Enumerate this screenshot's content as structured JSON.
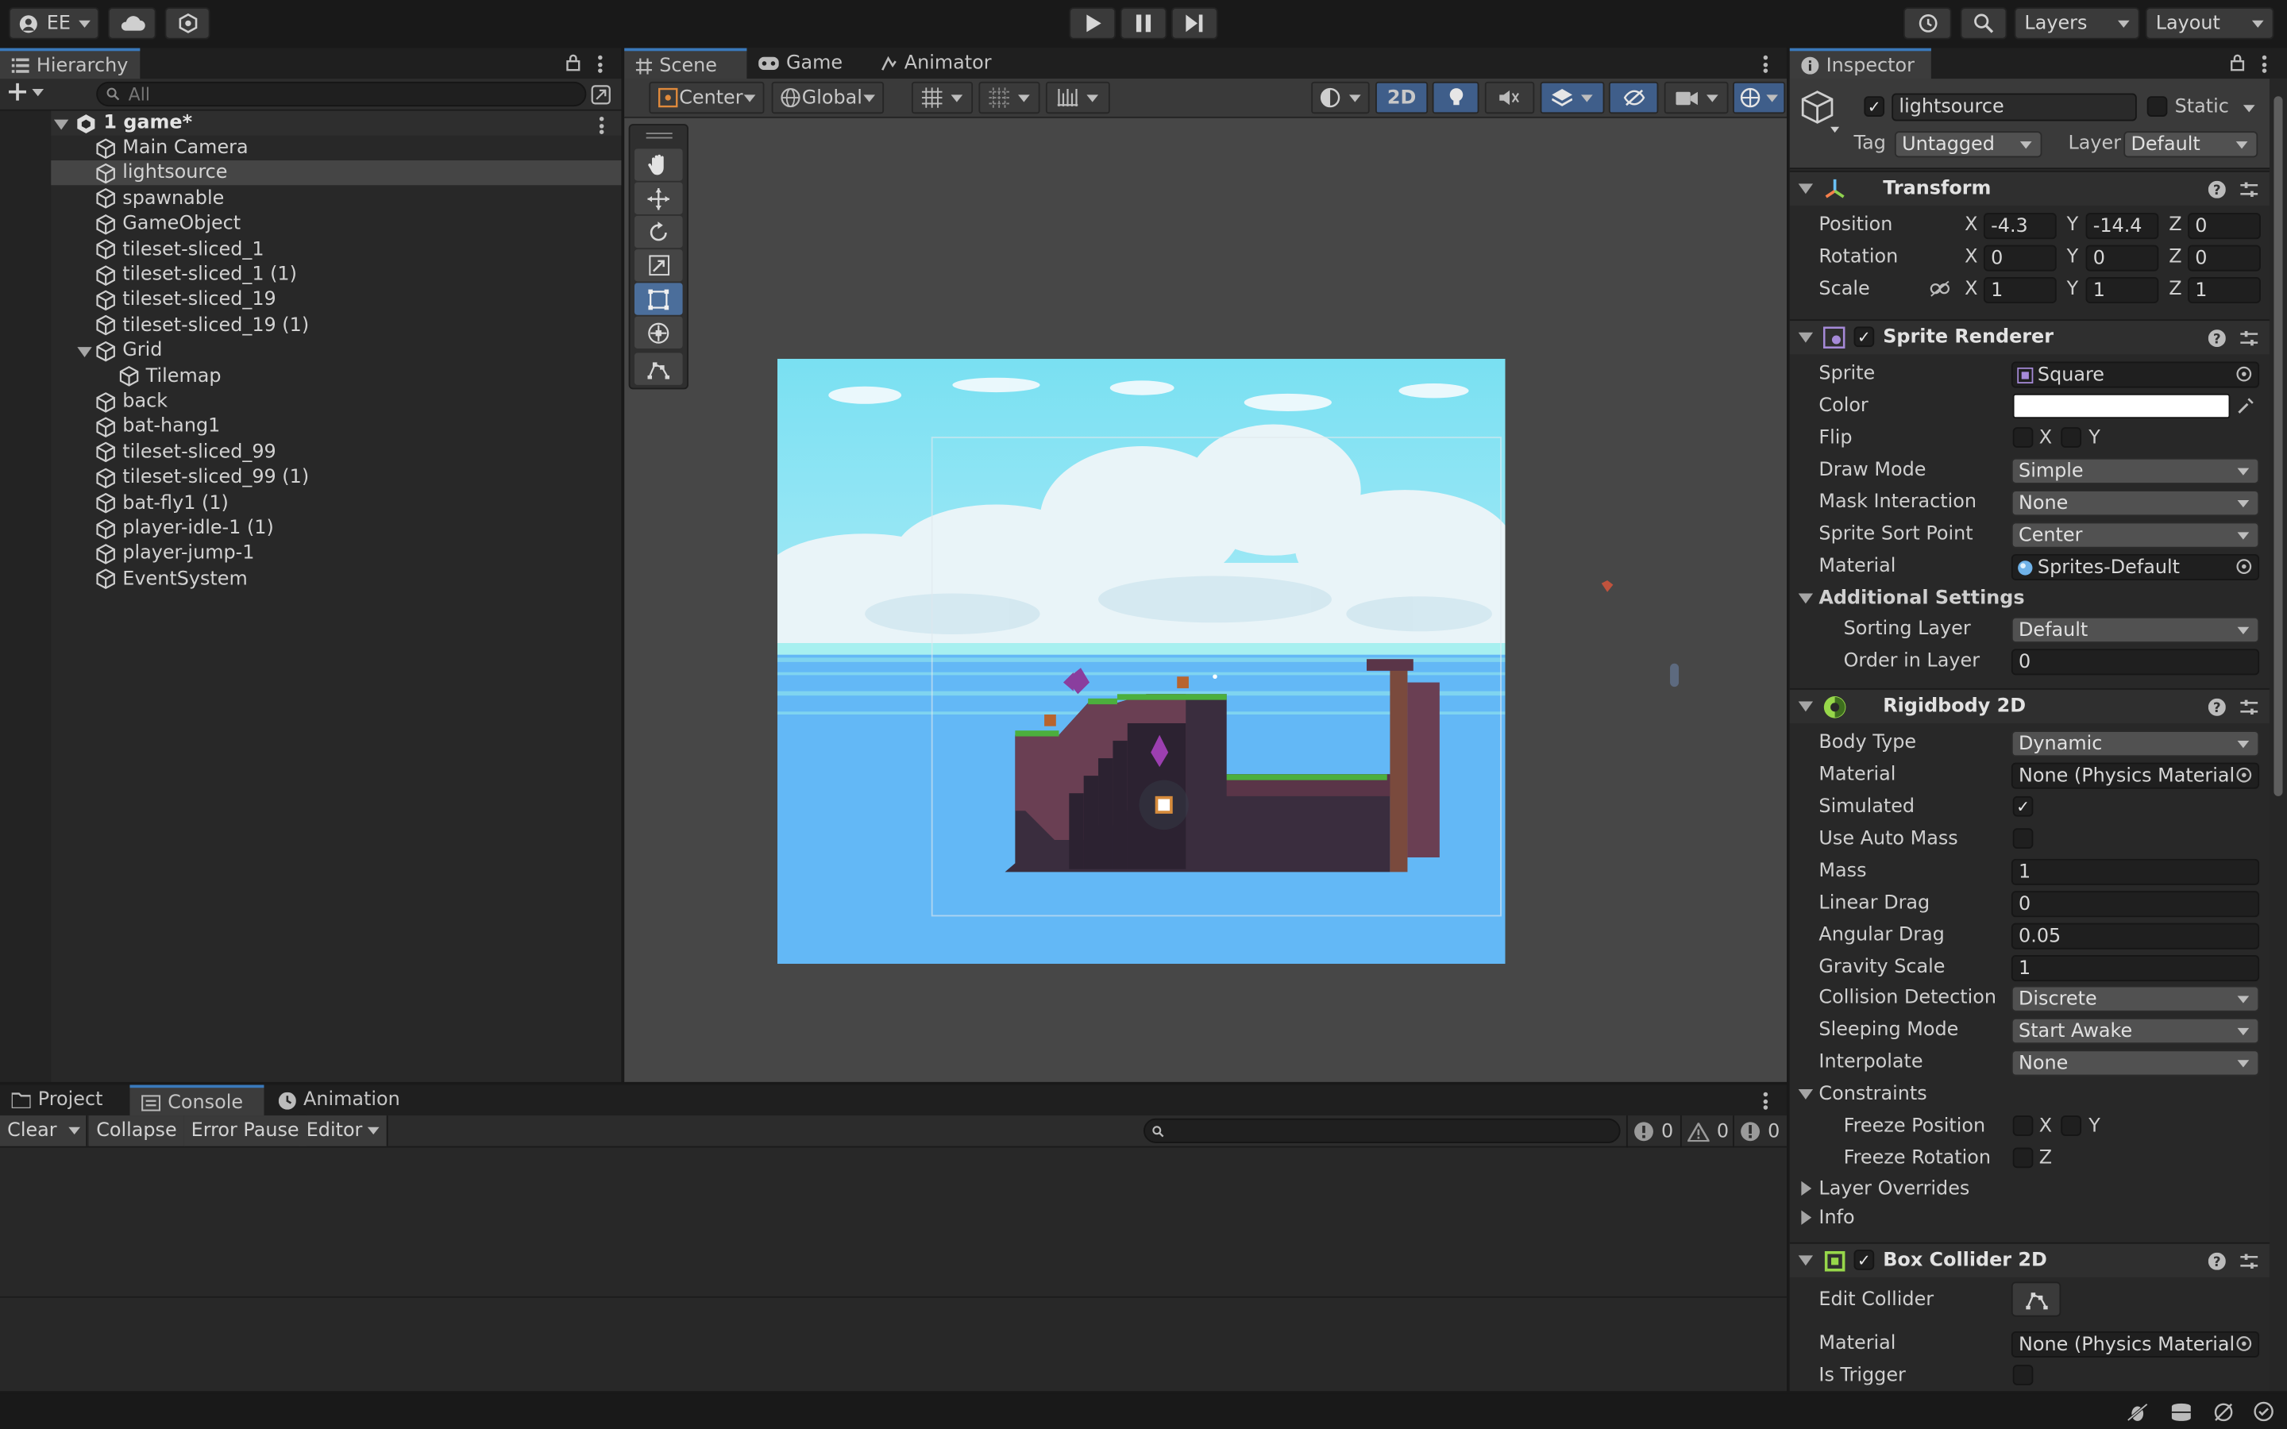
{
  "topbar": {
    "account_label": "EE",
    "layers_label": "Layers",
    "layout_label": "Layout"
  },
  "hierarchy": {
    "tab_label": "Hierarchy",
    "search_placeholder": "All",
    "scene_name": "1 game*",
    "items": [
      {
        "label": "Main Camera",
        "indent": 1
      },
      {
        "label": "lightsource",
        "indent": 1,
        "selected": true
      },
      {
        "label": "spawnable",
        "indent": 1
      },
      {
        "label": "GameObject",
        "indent": 1
      },
      {
        "label": "tileset-sliced_1",
        "indent": 1
      },
      {
        "label": "tileset-sliced_1 (1)",
        "indent": 1
      },
      {
        "label": "tileset-sliced_19",
        "indent": 1
      },
      {
        "label": "tileset-sliced_19 (1)",
        "indent": 1
      },
      {
        "label": "Grid",
        "indent": 1,
        "expanded": true
      },
      {
        "label": "Tilemap",
        "indent": 2
      },
      {
        "label": "back",
        "indent": 1
      },
      {
        "label": "bat-hang1",
        "indent": 1
      },
      {
        "label": "tileset-sliced_99",
        "indent": 1
      },
      {
        "label": "tileset-sliced_99 (1)",
        "indent": 1
      },
      {
        "label": "bat-fly1 (1)",
        "indent": 1
      },
      {
        "label": "player-idle-1 (1)",
        "indent": 1
      },
      {
        "label": "player-jump-1",
        "indent": 1
      },
      {
        "label": "EventSystem",
        "indent": 1
      }
    ]
  },
  "scene": {
    "tabs": [
      "Scene",
      "Game",
      "Animator"
    ],
    "pivot_label": "Center",
    "space_label": "Global",
    "mode_2d_label": "2D"
  },
  "console": {
    "tabs": [
      "Project",
      "Console",
      "Animation"
    ],
    "buttons": [
      "Clear",
      "Collapse",
      "Error Pause",
      "Editor"
    ],
    "log_count": "0",
    "warn_count": "0",
    "error_count": "0"
  },
  "inspector": {
    "tab_label": "Inspector",
    "object_name": "lightsource",
    "static_label": "Static",
    "tag_label": "Tag",
    "tag_value": "Untagged",
    "layer_label": "Layer",
    "layer_value": "Default",
    "transform": {
      "title": "Transform",
      "position_label": "Position",
      "rotation_label": "Rotation",
      "scale_label": "Scale",
      "position": {
        "x": "-4.3",
        "y": "-14.4",
        "z": "0"
      },
      "rotation": {
        "x": "0",
        "y": "0",
        "z": "0"
      },
      "scale": {
        "x": "1",
        "y": "1",
        "z": "1"
      }
    },
    "sprite_renderer": {
      "title": "Sprite Renderer",
      "sprite_label": "Sprite",
      "sprite_value": "Square",
      "color_label": "Color",
      "color_value": "#ffffff",
      "flip_label": "Flip",
      "draw_mode_label": "Draw Mode",
      "draw_mode_value": "Simple",
      "mask_label": "Mask Interaction",
      "mask_value": "None",
      "sort_point_label": "Sprite Sort Point",
      "sort_point_value": "Center",
      "material_label": "Material",
      "material_value": "Sprites-Default",
      "additional_label": "Additional Settings",
      "sorting_layer_label": "Sorting Layer",
      "sorting_layer_value": "Default",
      "order_label": "Order in Layer",
      "order_value": "0"
    },
    "rigidbody": {
      "title": "Rigidbody 2D",
      "body_type_label": "Body Type",
      "body_type_value": "Dynamic",
      "material_label": "Material",
      "material_value": "None (Physics Material",
      "simulated_label": "Simulated",
      "auto_mass_label": "Use Auto Mass",
      "mass_label": "Mass",
      "mass_value": "1",
      "linear_drag_label": "Linear Drag",
      "linear_drag_value": "0",
      "angular_drag_label": "Angular Drag",
      "angular_drag_value": "0.05",
      "gravity_label": "Gravity Scale",
      "gravity_value": "1",
      "collision_label": "Collision Detection",
      "collision_value": "Discrete",
      "sleeping_label": "Sleeping Mode",
      "sleeping_value": "Start Awake",
      "interpolate_label": "Interpolate",
      "interpolate_value": "None",
      "constraints_label": "Constraints",
      "freeze_pos_label": "Freeze Position",
      "freeze_rot_label": "Freeze Rotation",
      "layer_overrides_label": "Layer Overrides",
      "info_label": "Info"
    },
    "box_collider": {
      "title": "Box Collider 2D",
      "edit_label": "Edit Collider",
      "material_label": "Material",
      "material_value": "None (Physics Material",
      "trigger_label": "Is Trigger"
    },
    "axes": {
      "x": "X",
      "y": "Y",
      "z": "Z"
    }
  }
}
